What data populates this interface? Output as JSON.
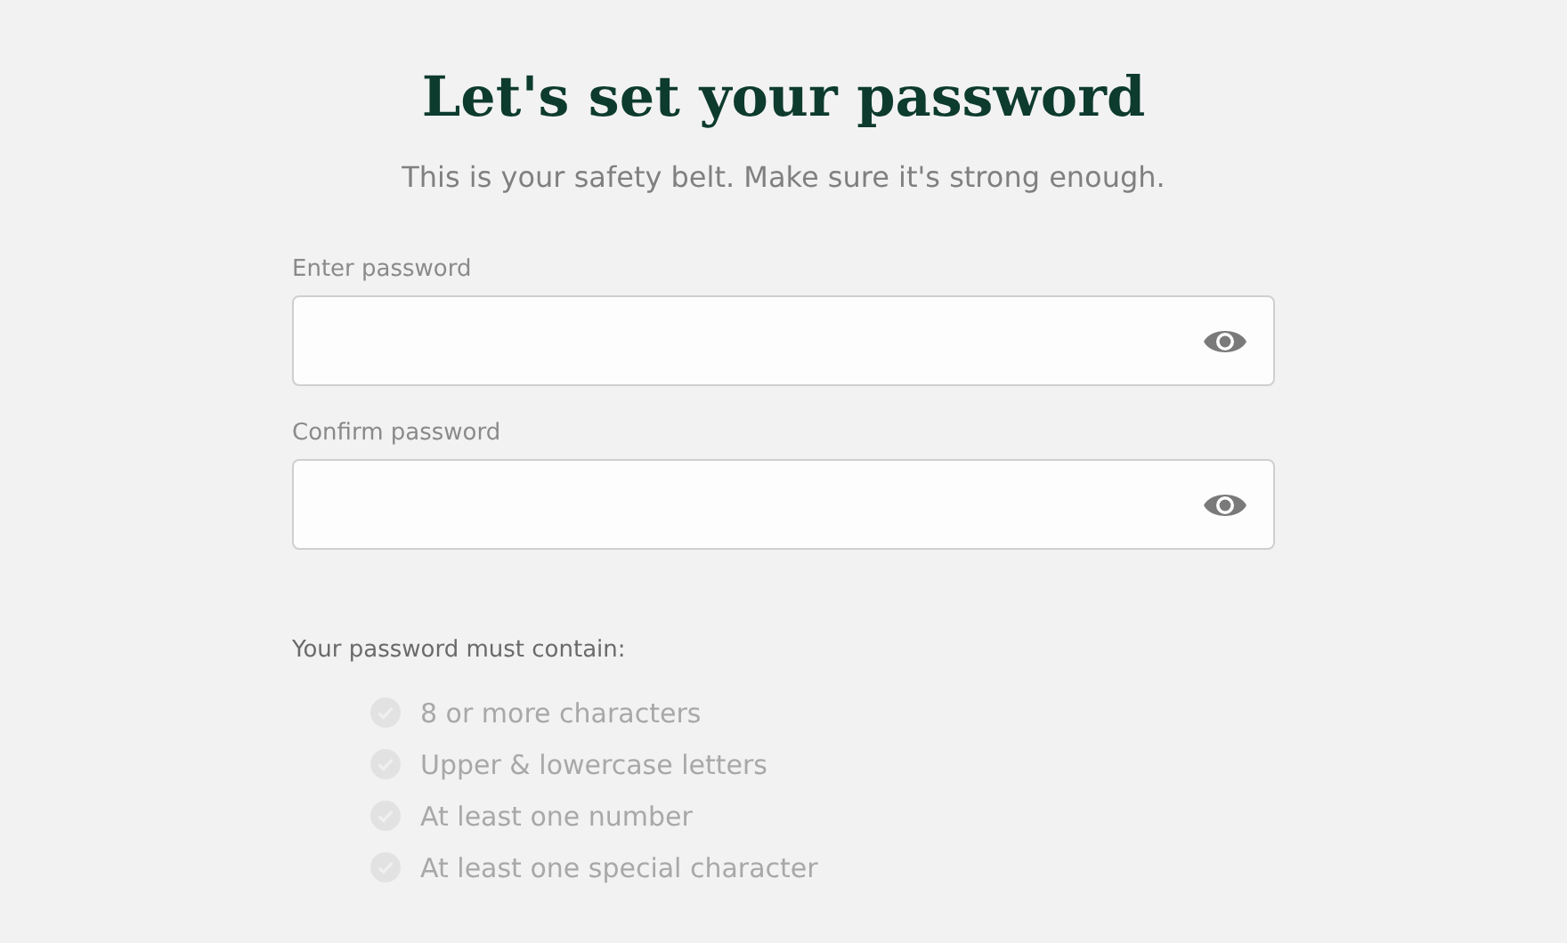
{
  "title": "Let's set your password",
  "subtitle": "This is your safety belt. Make sure it's strong enough.",
  "fields": [
    {
      "label": "Enter password"
    },
    {
      "label": "Confirm password"
    }
  ],
  "requirements": {
    "heading": "Your password must contain:",
    "items": [
      {
        "text": "8 or more characters",
        "met": false
      },
      {
        "text": "Upper & lowercase letters",
        "met": false
      },
      {
        "text": "At least one number",
        "met": false
      },
      {
        "text": "At least one special character",
        "met": false
      }
    ]
  }
}
